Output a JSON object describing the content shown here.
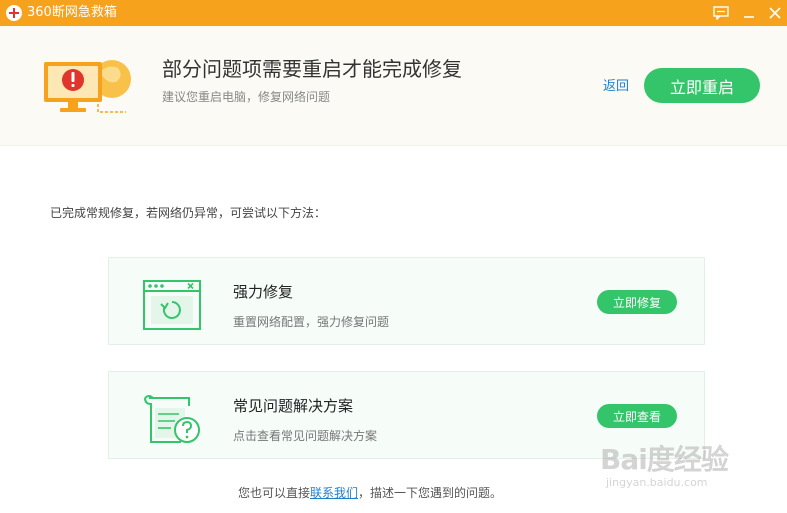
{
  "window": {
    "title": "360断网急救箱",
    "theme_color": "#f7a21c"
  },
  "header": {
    "headline": "部分问题项需要重启才能完成修复",
    "subline": "建议您重启电脑，修复网络问题",
    "back_label": "返回",
    "restart_label": "立即重启"
  },
  "main": {
    "intro": "已完成常规修复，若网络仍异常，可尝试以下方法：",
    "cards": [
      {
        "title": "强力修复",
        "desc": "重置网络配置，强力修复问题",
        "button": "立即修复",
        "icon": "window-refresh-icon"
      },
      {
        "title": "常见问题解决方案",
        "desc": "点击查看常见问题解决方案",
        "button": "立即查看",
        "icon": "document-question-icon"
      }
    ]
  },
  "footer": {
    "prefix": "您也可以直接",
    "link": "联系我们",
    "suffix": "，描述一下您遇到的问题。"
  },
  "watermark": {
    "main": "Bai度经验",
    "sub": "jingyan.baidu.com"
  },
  "colors": {
    "accent_green": "#34c46a",
    "link_blue": "#1f7fcf"
  }
}
